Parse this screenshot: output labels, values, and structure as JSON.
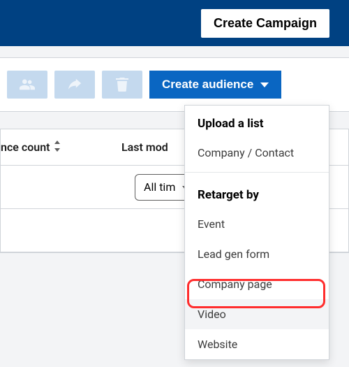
{
  "header": {
    "create_campaign": "Create Campaign"
  },
  "toolbar": {
    "create_audience": "Create audience"
  },
  "table": {
    "col_count": "nce count",
    "col_modified": "Last mod",
    "filter_time": "All tim"
  },
  "dropdown": {
    "upload_label": "Upload a list",
    "upload_items": [
      "Company / Contact"
    ],
    "retarget_label": "Retarget by",
    "retarget_items": [
      "Event",
      "Lead gen form",
      "Company page",
      "Video",
      "Website"
    ]
  }
}
